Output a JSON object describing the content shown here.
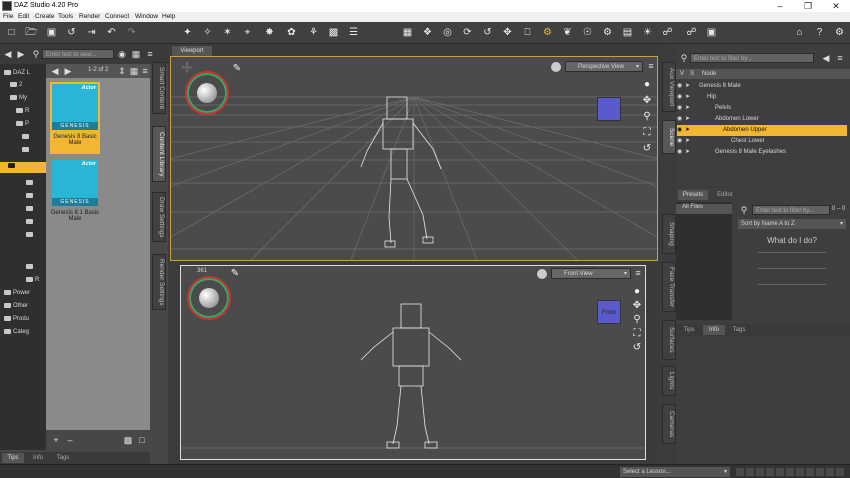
{
  "window": {
    "title": "DAZ Studio 4.20 Pro",
    "minimize": "–",
    "maximize": "❐",
    "close": "✕"
  },
  "menu": [
    "File",
    "Edit",
    "Create",
    "Tools",
    "Render",
    "Connect",
    "Window",
    "Help"
  ],
  "toolbar_icons": [
    "new-file-icon",
    "open-folder-icon",
    "save-icon",
    "merge-icon",
    "export-icon",
    "undo-icon",
    "redo-icon",
    "node-selection-icon",
    "universal-tool-icon",
    "rotate-tool-icon",
    "translate-tool-icon",
    "scale-tool-icon",
    "active-pose-icon",
    "joint-editor-icon",
    "geometry-editor-icon",
    "surface-selection-icon",
    "node-weight-icon",
    "render-icon",
    "viewport-layout-icon",
    "camera-orbit-icon",
    "camera-rotate-icon",
    "camera-pan-icon",
    "camera-dolly-icon",
    "camera-frame-icon",
    "spot-render-icon",
    "pose-tool-icon",
    "figure-icon",
    "camera-icon",
    "render-settings-icon",
    "light-icon",
    "render-image-icon",
    "link-icon",
    "layout-icon",
    "help-icon",
    "tips-icon"
  ],
  "left": {
    "search_placeholder": "Enter text to sear...",
    "page_info": "1-2 of 2",
    "tree": [
      {
        "label": "DAZ L",
        "level": 0
      },
      {
        "label": "2",
        "level": 1
      },
      {
        "label": "My",
        "level": 1
      },
      {
        "label": "R",
        "level": 2
      },
      {
        "label": "P",
        "level": 2
      },
      {
        "label": "",
        "level": 2
      },
      {
        "label": "",
        "level": 2
      },
      {
        "label": "",
        "level": 2
      },
      {
        "label": "",
        "level": 2
      },
      {
        "label": "",
        "level": 2
      },
      {
        "label": "",
        "level": 2
      },
      {
        "label": "",
        "level": 2
      },
      {
        "label": "",
        "level": 2
      },
      {
        "label": "R",
        "level": 2
      },
      {
        "label": "Power",
        "level": 0
      },
      {
        "label": "Other",
        "level": 0
      },
      {
        "label": "Produ",
        "level": 0
      },
      {
        "label": "Categ",
        "level": 0
      }
    ],
    "products": [
      {
        "name": "Genesis 8 Basic Male",
        "badge": "Actor",
        "brand": "GENESIS",
        "selected": true
      },
      {
        "name": "Genesis 8.1 Basic Male",
        "badge": "Actor",
        "brand": "GENESIS",
        "selected": false
      }
    ],
    "add_label": "+",
    "remove_label": "–",
    "bottom_tabs": [
      "Tips",
      "Info",
      "Tags"
    ]
  },
  "side_tabs_left": [
    "Smart Content",
    "Content Library",
    "Draw Settings",
    "Render Settings"
  ],
  "viewport": {
    "tab": "Viewport",
    "top_view": "Perspective View",
    "bottom_view": "Front View",
    "bottom_counter": "361",
    "front_label": "Front"
  },
  "scene": {
    "search_placeholder": "Enter text to filter by...",
    "header_cols": [
      "V",
      "S",
      "Node"
    ],
    "nodes": [
      {
        "label": "Genesis 8 Male",
        "indent": 0,
        "selected": false
      },
      {
        "label": "Hip",
        "indent": 1,
        "selected": false
      },
      {
        "label": "Pelvis",
        "indent": 2,
        "selected": false
      },
      {
        "label": "Abdomen Lower",
        "indent": 2,
        "selected": false
      },
      {
        "label": "Abdomen Upper",
        "indent": 3,
        "selected": true
      },
      {
        "label": "Chest Lower",
        "indent": 4,
        "selected": false
      },
      {
        "label": "Genesis 8 Male Eyelashes",
        "indent": 0,
        "selected": false
      }
    ]
  },
  "side_tabs_right": [
    "Aux Viewport",
    "Scene",
    "Shaping",
    "Face Transfer",
    "Surfaces",
    "Lights",
    "Cameras"
  ],
  "presets": {
    "tabs": [
      "Presets",
      "Editor"
    ],
    "files_label": "All Files",
    "search_placeholder": "Enter text to filter by...",
    "count": "0 – 0",
    "sort": "Sort by Name  A to Z",
    "heading": "What do I do?",
    "bottom_tabs": [
      "Tips",
      "Info",
      "Tags"
    ]
  },
  "status": {
    "lesson_placeholder": "Select a Lesson..."
  },
  "colors": {
    "selected": "#f2b632",
    "accent_blue": "#29b5d6"
  }
}
